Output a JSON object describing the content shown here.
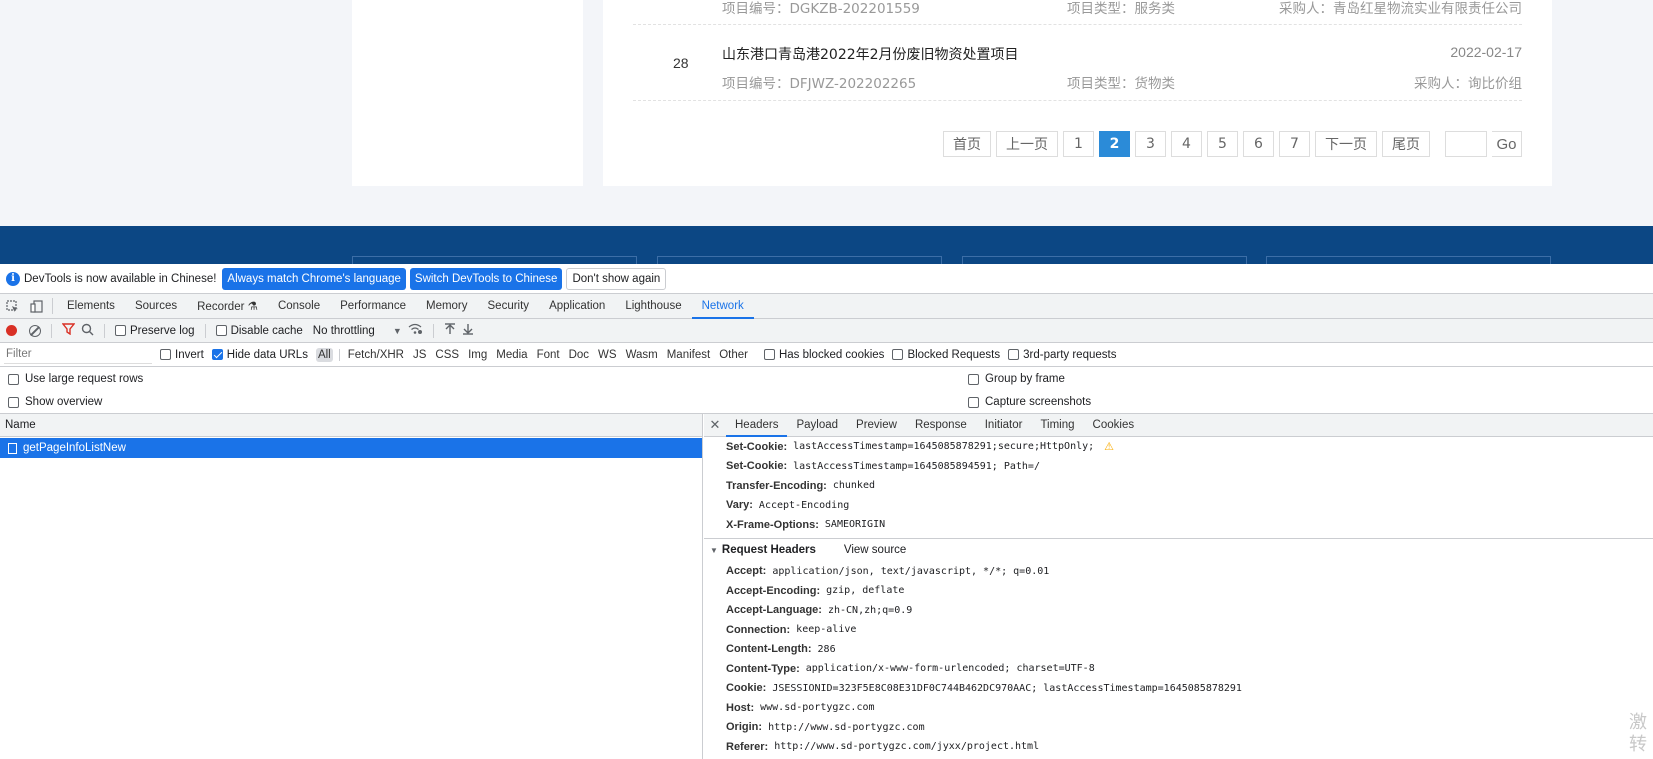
{
  "web": {
    "rows": [
      {
        "num": "",
        "title": "",
        "date": "",
        "code": "项目编号：DGKZB-202201559",
        "type": "项目类型：服务类",
        "buyer": "采购人：青岛红星物流实业有限责任公司"
      },
      {
        "num": "28",
        "title": "山东港口青岛港2022年2月份废旧物资处置项目",
        "date": "2022-02-17",
        "code": "项目编号：DFJWZ-202202265",
        "type": "项目类型：货物类",
        "buyer": "采购人：询比价组"
      }
    ],
    "pager": {
      "first": "首页",
      "prev": "上一页",
      "pages": [
        "1",
        "2",
        "3",
        "4",
        "5",
        "6",
        "7"
      ],
      "current": "2",
      "next": "下一页",
      "last": "尾页",
      "go": "Go"
    },
    "colors": {
      "footer_band": "#0c4784",
      "pager_active": "#2b8bd8"
    }
  },
  "devtools": {
    "infobar": {
      "message": "DevTools is now available in Chinese!",
      "btn_match": "Always match Chrome's language",
      "btn_switch": "Switch DevTools to Chinese",
      "btn_dismiss": "Don't show again"
    },
    "tabs": [
      "Elements",
      "Sources",
      "Recorder ⚗",
      "Console",
      "Performance",
      "Memory",
      "Security",
      "Application",
      "Lighthouse",
      "Network"
    ],
    "active_tab": "Network",
    "toolbar": {
      "preserve_log": "Preserve log",
      "disable_cache": "Disable cache",
      "throttling": "No throttling"
    },
    "filter": {
      "placeholder": "Filter",
      "invert": "Invert",
      "hide_data_urls": "Hide data URLs",
      "types": [
        "All",
        "Fetch/XHR",
        "JS",
        "CSS",
        "Img",
        "Media",
        "Font",
        "Doc",
        "WS",
        "Wasm",
        "Manifest",
        "Other"
      ],
      "has_blocked_cookies": "Has blocked cookies",
      "blocked_requests": "Blocked Requests",
      "third_party": "3rd-party requests"
    },
    "settings": {
      "large_rows": "Use large request rows",
      "show_overview": "Show overview",
      "group_by_frame": "Group by frame",
      "capture_screenshots": "Capture screenshots"
    },
    "list": {
      "name_header": "Name",
      "requests": [
        "getPageInfoListNew"
      ]
    },
    "detail_tabs": [
      "Headers",
      "Payload",
      "Preview",
      "Response",
      "Initiator",
      "Timing",
      "Cookies"
    ],
    "response_headers": [
      {
        "key": "Set-Cookie:",
        "value": "lastAccessTimestamp=1645085878291;secure;HttpOnly;",
        "warn": true
      },
      {
        "key": "Set-Cookie:",
        "value": "lastAccessTimestamp=1645085894591; Path=/"
      },
      {
        "key": "Transfer-Encoding:",
        "value": "chunked"
      },
      {
        "key": "Vary:",
        "value": "Accept-Encoding"
      },
      {
        "key": "X-Frame-Options:",
        "value": "SAMEORIGIN"
      }
    ],
    "request_section": {
      "title": "Request Headers",
      "view_source": "View source"
    },
    "request_headers": [
      {
        "key": "Accept:",
        "value": "application/json, text/javascript, */*; q=0.01"
      },
      {
        "key": "Accept-Encoding:",
        "value": "gzip, deflate"
      },
      {
        "key": "Accept-Language:",
        "value": "zh-CN,zh;q=0.9"
      },
      {
        "key": "Connection:",
        "value": "keep-alive"
      },
      {
        "key": "Content-Length:",
        "value": "286"
      },
      {
        "key": "Content-Type:",
        "value": "application/x-www-form-urlencoded; charset=UTF-8"
      },
      {
        "key": "Cookie:",
        "value": "JSESSIONID=323F5E8C08E31DF0C744B462DC970AAC; lastAccessTimestamp=1645085878291"
      },
      {
        "key": "Host:",
        "value": "www.sd-portygzc.com"
      },
      {
        "key": "Origin:",
        "value": "http://www.sd-portygzc.com"
      },
      {
        "key": "Referer:",
        "value": "http://www.sd-portygzc.com/jyxx/project.html"
      }
    ]
  },
  "watermark": "激\n转"
}
